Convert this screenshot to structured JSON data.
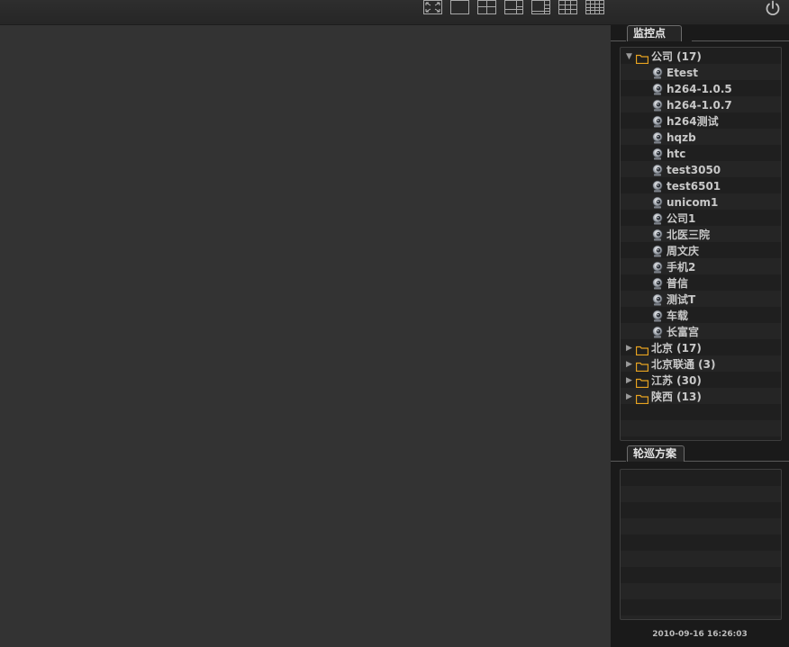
{
  "toolbar": {
    "layouts": [
      {
        "name": "fullscreen-button",
        "icon": "fullscreen-icon"
      },
      {
        "name": "layout-1-button",
        "icon": "layout-1-icon"
      },
      {
        "name": "layout-4-button",
        "icon": "layout-4-icon"
      },
      {
        "name": "layout-6-button",
        "icon": "layout-6-icon"
      },
      {
        "name": "layout-8-button",
        "icon": "layout-8-icon"
      },
      {
        "name": "layout-9-button",
        "icon": "layout-9-icon"
      },
      {
        "name": "layout-16-button",
        "icon": "layout-16-icon"
      }
    ],
    "power_icon": "power-icon"
  },
  "monitor_panel": {
    "title": "监控点",
    "tree": [
      {
        "type": "folder",
        "label": "公司 (17)",
        "expanded": true
      },
      {
        "type": "camera",
        "label": "Etest"
      },
      {
        "type": "camera",
        "label": "h264-1.0.5"
      },
      {
        "type": "camera",
        "label": "h264-1.0.7"
      },
      {
        "type": "camera",
        "label": "h264测试"
      },
      {
        "type": "camera",
        "label": "hqzb"
      },
      {
        "type": "camera",
        "label": "htc"
      },
      {
        "type": "camera",
        "label": "test3050"
      },
      {
        "type": "camera",
        "label": "test6501"
      },
      {
        "type": "camera",
        "label": "unicom1"
      },
      {
        "type": "camera",
        "label": "公司1"
      },
      {
        "type": "camera",
        "label": "北医三院"
      },
      {
        "type": "camera",
        "label": "周文庆"
      },
      {
        "type": "camera",
        "label": "手机2"
      },
      {
        "type": "camera",
        "label": "普信"
      },
      {
        "type": "camera",
        "label": "测试T"
      },
      {
        "type": "camera",
        "label": "车载"
      },
      {
        "type": "camera",
        "label": "长富宫"
      },
      {
        "type": "folder",
        "label": "北京 (17)",
        "expanded": false
      },
      {
        "type": "folder",
        "label": "北京联通 (3)",
        "expanded": false
      },
      {
        "type": "folder",
        "label": "江苏 (30)",
        "expanded": false
      },
      {
        "type": "folder",
        "label": "陕西 (13)",
        "expanded": false
      }
    ]
  },
  "patrol_panel": {
    "title": "轮巡方案",
    "items": []
  },
  "status": {
    "datetime": "2010-09-16 16:26:03"
  },
  "colors": {
    "background": "#333333",
    "panel": "#1a1a1a",
    "folder": "#e8a320",
    "text": "#c8c8c8"
  }
}
